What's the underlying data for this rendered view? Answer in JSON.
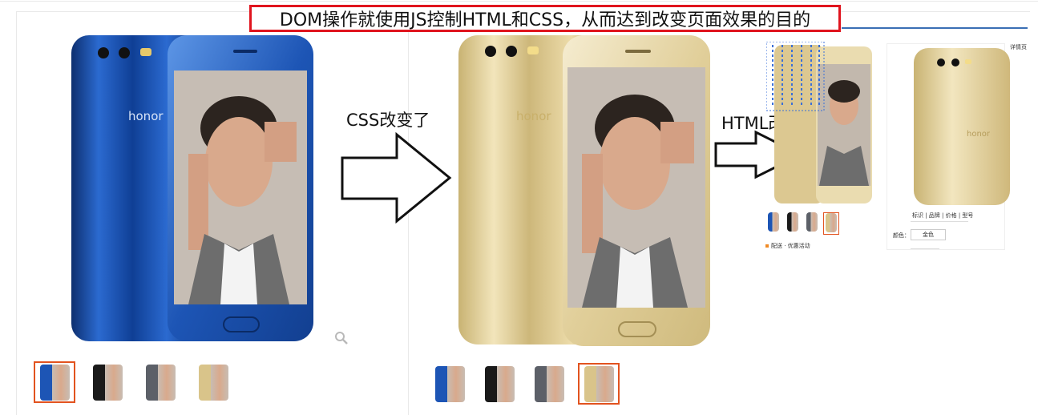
{
  "title": "DOM操作就使用JS控制HTML和CSS，从而达到改变页面效果的目的",
  "arrow1_label": "CSS改变了",
  "arrow2_label": "HTML改变了",
  "phone1": {
    "body_color": "#1d55b5",
    "brand": "honor"
  },
  "phone2": {
    "body_color": "#d9c48a",
    "brand": "honor"
  },
  "colors": {
    "accent": "#e0141e",
    "selected_border": "#e2531f",
    "blue_rule": "#3a6fb5"
  },
  "thumbnails_left": [
    {
      "color": "#1d55b5",
      "selected": true
    },
    {
      "color": "#1a1a1a",
      "selected": false
    },
    {
      "color": "#5c6068",
      "selected": false
    },
    {
      "color": "#d9c48a",
      "selected": false
    }
  ],
  "thumbnails_middle": [
    {
      "color": "#1d55b5",
      "selected": false
    },
    {
      "color": "#1a1a1a",
      "selected": false
    },
    {
      "color": "#5c6068",
      "selected": false
    },
    {
      "color": "#d9c48a",
      "selected": true
    }
  ],
  "mini_thumbnails": [
    {
      "color": "#1d55b5",
      "selected": false
    },
    {
      "color": "#1a1a1a",
      "selected": false
    },
    {
      "color": "#5c6068",
      "selected": false
    },
    {
      "color": "#d9c48a",
      "selected": true
    }
  ],
  "mini_text": {
    "top_right": "详情页",
    "row1": "标识 | 品牌 | 价格 | 型号",
    "row2_label": "颜色：",
    "row2_value": "金色",
    "foot": "配送 · 优惠活动"
  },
  "icons": {
    "zoom": "magnifier-icon"
  }
}
